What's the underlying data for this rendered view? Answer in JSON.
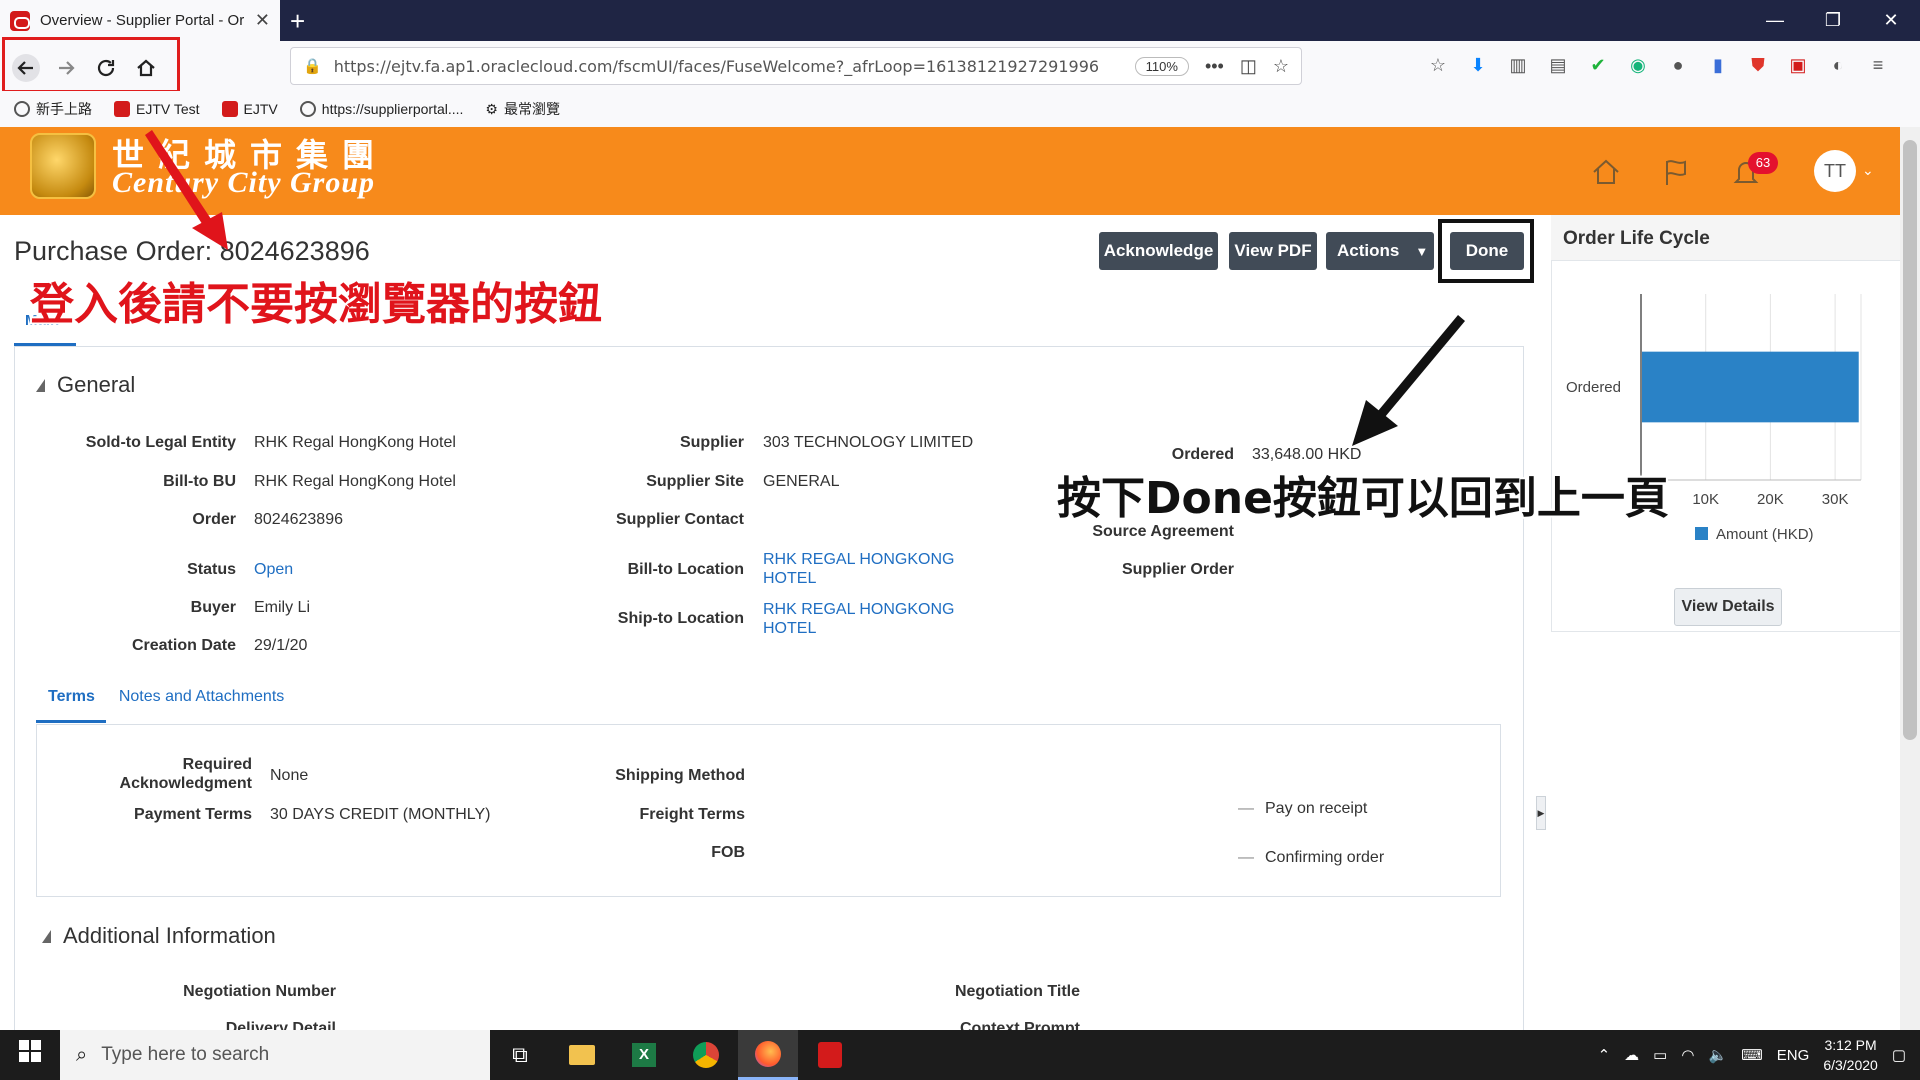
{
  "browser": {
    "tab_title": "Overview - Supplier Portal - Or",
    "new_tab": "+",
    "url": "https://ejtv.fa.ap1.oraclecloud.com/fscmUI/faces/FuseWelcome?_afrLoop=16138121927291996",
    "zoom": "110%",
    "window_controls": [
      "—",
      "❐",
      "✕"
    ]
  },
  "bookmarks": [
    {
      "label": "新手上路",
      "color": "#555555"
    },
    {
      "label": "EJTV Test",
      "color": "#d31b1b"
    },
    {
      "label": "EJTV",
      "color": "#d31b1b"
    },
    {
      "label": "https://supplierportal....",
      "color": "#555555"
    },
    {
      "label": "最常瀏覽",
      "color": "#555555"
    }
  ],
  "brand": {
    "name_cn": "世紀城市集團",
    "name_en": "Century City Group",
    "notification_count": "63",
    "user_initials": "TT"
  },
  "page": {
    "title": "Purchase Order: 8024623896",
    "tab_main": "Main",
    "buttons": {
      "acknowledge": "Acknowledge",
      "view_pdf": "View PDF",
      "actions": "Actions",
      "done": "Done"
    }
  },
  "general": {
    "title": "General",
    "fields": {
      "sold_to_label": "Sold-to Legal Entity",
      "sold_to_value": "RHK Regal HongKong Hotel",
      "bill_to_bu_label": "Bill-to BU",
      "bill_to_bu_value": "RHK Regal HongKong Hotel",
      "order_label": "Order",
      "order_value": "8024623896",
      "status_label": "Status",
      "status_value": "Open",
      "buyer_label": "Buyer",
      "buyer_value": "Emily Li",
      "creation_date_label": "Creation Date",
      "creation_date_value": "29/1/20",
      "supplier_label": "Supplier",
      "supplier_value": "303 TECHNOLOGY LIMITED",
      "supplier_site_label": "Supplier Site",
      "supplier_site_value": "GENERAL",
      "supplier_contact_label": "Supplier Contact",
      "bill_to_location_label": "Bill-to Location",
      "bill_to_location_value_1": "RHK REGAL HONGKONG",
      "bill_to_location_value_2": "HOTEL",
      "ship_to_location_label": "Ship-to Location",
      "ship_to_location_value_1": "RHK REGAL HONGKONG",
      "ship_to_location_value_2": "HOTEL",
      "ordered_label": "Ordered",
      "ordered_value": "33,648.00",
      "ordered_currency": "HKD",
      "source_agreement_label": "Source Agreement",
      "supplier_order_label": "Supplier Order"
    }
  },
  "subtabs": {
    "terms": "Terms",
    "notes": "Notes and Attachments"
  },
  "terms": {
    "required_ack_label_1": "Required",
    "required_ack_label_2": "Acknowledgment",
    "required_ack_value": "None",
    "payment_terms_label": "Payment Terms",
    "payment_terms_value": "30 DAYS CREDIT (MONTHLY)",
    "shipping_method_label": "Shipping Method",
    "freight_terms_label": "Freight Terms",
    "fob_label": "FOB",
    "pay_on_receipt": "Pay on receipt",
    "confirming_order": "Confirming order",
    "dash": "—"
  },
  "additional": {
    "title": "Additional Information",
    "negotiation_number_label": "Negotiation Number",
    "negotiation_title_label": "Negotiation Title",
    "delivery_detail_label": "Delivery Detail",
    "context_prompt_label": "Context Prompt"
  },
  "lifecycle": {
    "title": "Order Life Cycle",
    "view_details": "View Details"
  },
  "chart_data": {
    "type": "bar",
    "orientation": "horizontal",
    "categories": [
      "Ordered"
    ],
    "series": [
      {
        "name": "Amount (HKD)",
        "values": [
          33648
        ]
      }
    ],
    "xlim": [
      0,
      34000
    ],
    "x_ticks": [
      "10K",
      "20K",
      "30K"
    ],
    "x_tick_values": [
      10000,
      20000,
      30000
    ],
    "legend": "bottom",
    "color": "#2a82c6"
  },
  "annotations": {
    "red_text": "登入後請不要按瀏覽器的按鈕",
    "black_text": "按下Done按鈕可以回到上一頁"
  },
  "taskbar": {
    "search_placeholder": "Type here to search",
    "lang": "ENG",
    "time": "3:12 PM",
    "date": "6/3/2020"
  }
}
